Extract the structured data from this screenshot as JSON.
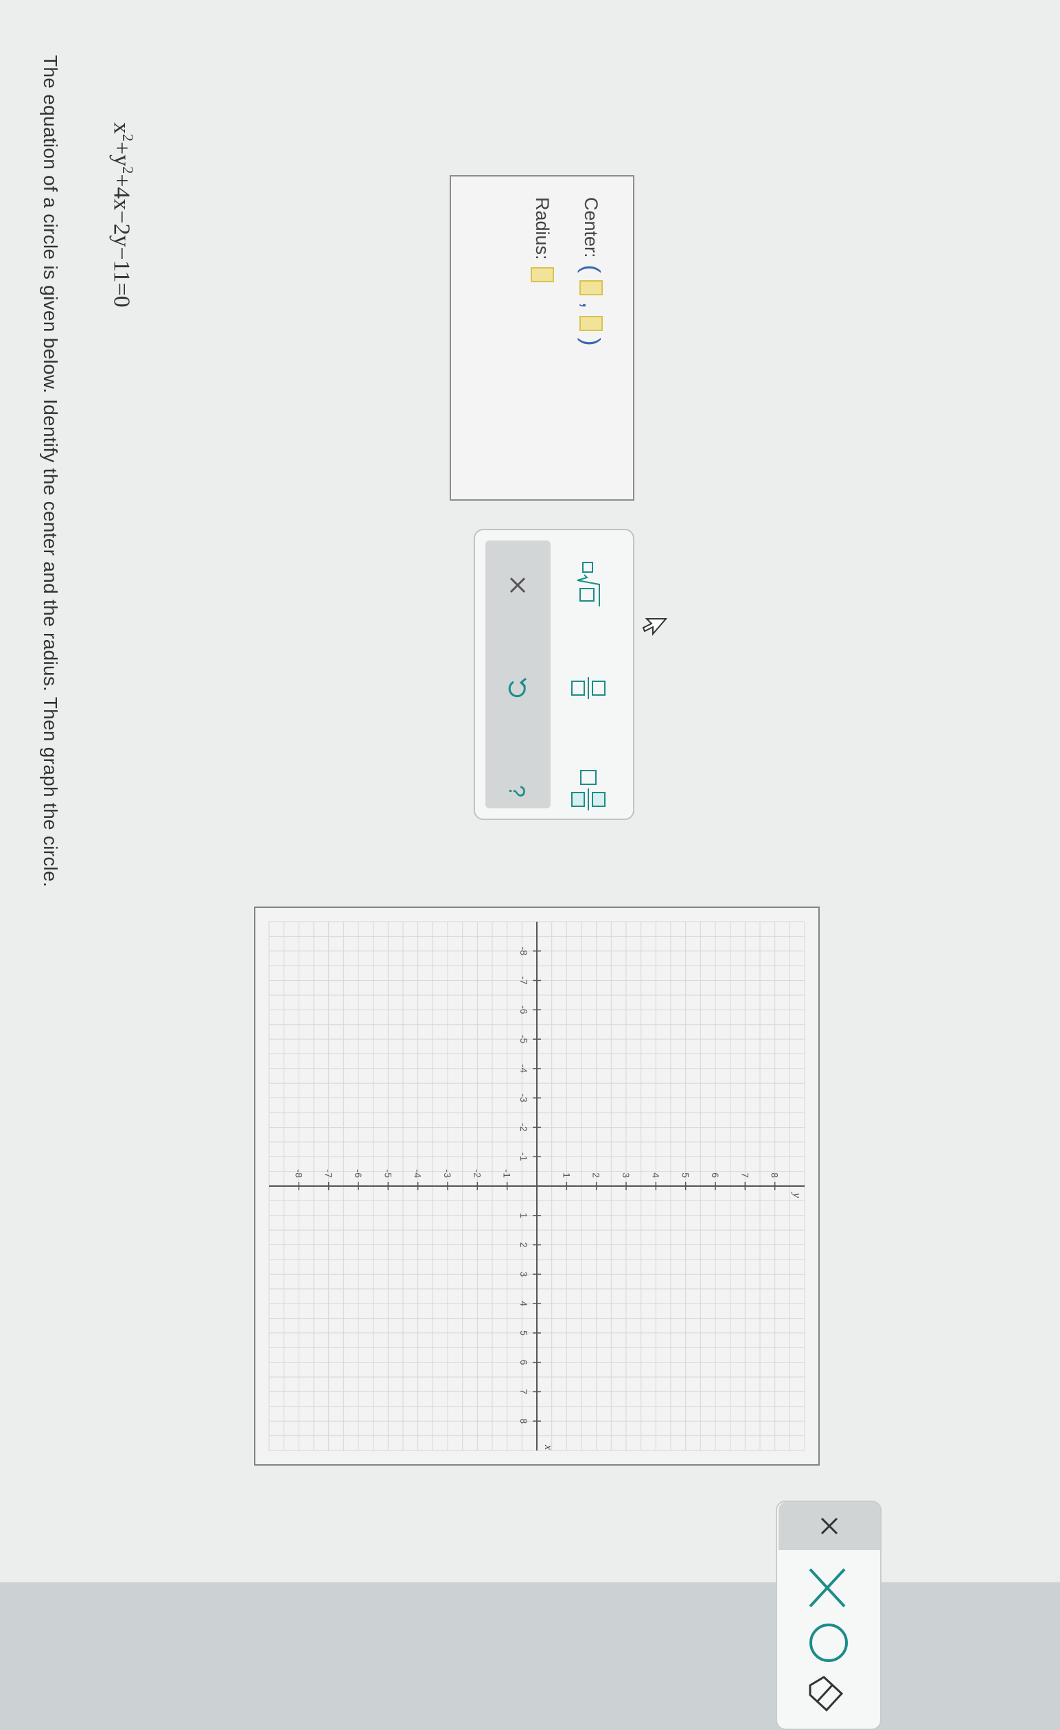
{
  "question": {
    "prompt": "The equation of a circle is given below. Identify the center and the radius. Then graph the circle.",
    "equation_html": "x<sup>2</sup>+y<sup>2</sup>+4x−2y−11=0"
  },
  "answer_box": {
    "center_label": "Center:",
    "radius_label": "Radius:",
    "open_paren": "(",
    "comma": ",",
    "close_paren": ")"
  },
  "keypad": {
    "keys": [
      {
        "name": "square-root-icon",
        "symbol": "□√□"
      },
      {
        "name": "fraction-icon",
        "symbol": "□/□"
      },
      {
        "name": "mixed-number-icon",
        "symbol": "□ □/□"
      }
    ],
    "actions": [
      {
        "name": "clear-icon",
        "symbol": "×"
      },
      {
        "name": "undo-icon",
        "symbol": "↺"
      },
      {
        "name": "help-icon",
        "symbol": "?"
      }
    ]
  },
  "graph": {
    "x_label": "x",
    "y_label": "y",
    "x_ticks": [
      "-8",
      "-7",
      "-6",
      "-5",
      "-4",
      "-3",
      "-2",
      "-1",
      "1",
      "2",
      "3",
      "4",
      "5",
      "6",
      "7",
      "8"
    ],
    "y_ticks": [
      "8",
      "7",
      "6",
      "5",
      "4",
      "3",
      "2",
      "1",
      "-1",
      "-2",
      "-3",
      "-4",
      "-5",
      "-6",
      "-7",
      "-8"
    ],
    "range": [
      -9,
      9
    ]
  },
  "toolbar": {
    "tools": [
      "clear-icon",
      "delete-icon",
      "circle-tool-icon",
      "eraser-icon"
    ]
  },
  "colors": {
    "accent": "#1b8d8a",
    "slot_fill": "#f2e39a",
    "paren_blue": "#3b67b1"
  }
}
